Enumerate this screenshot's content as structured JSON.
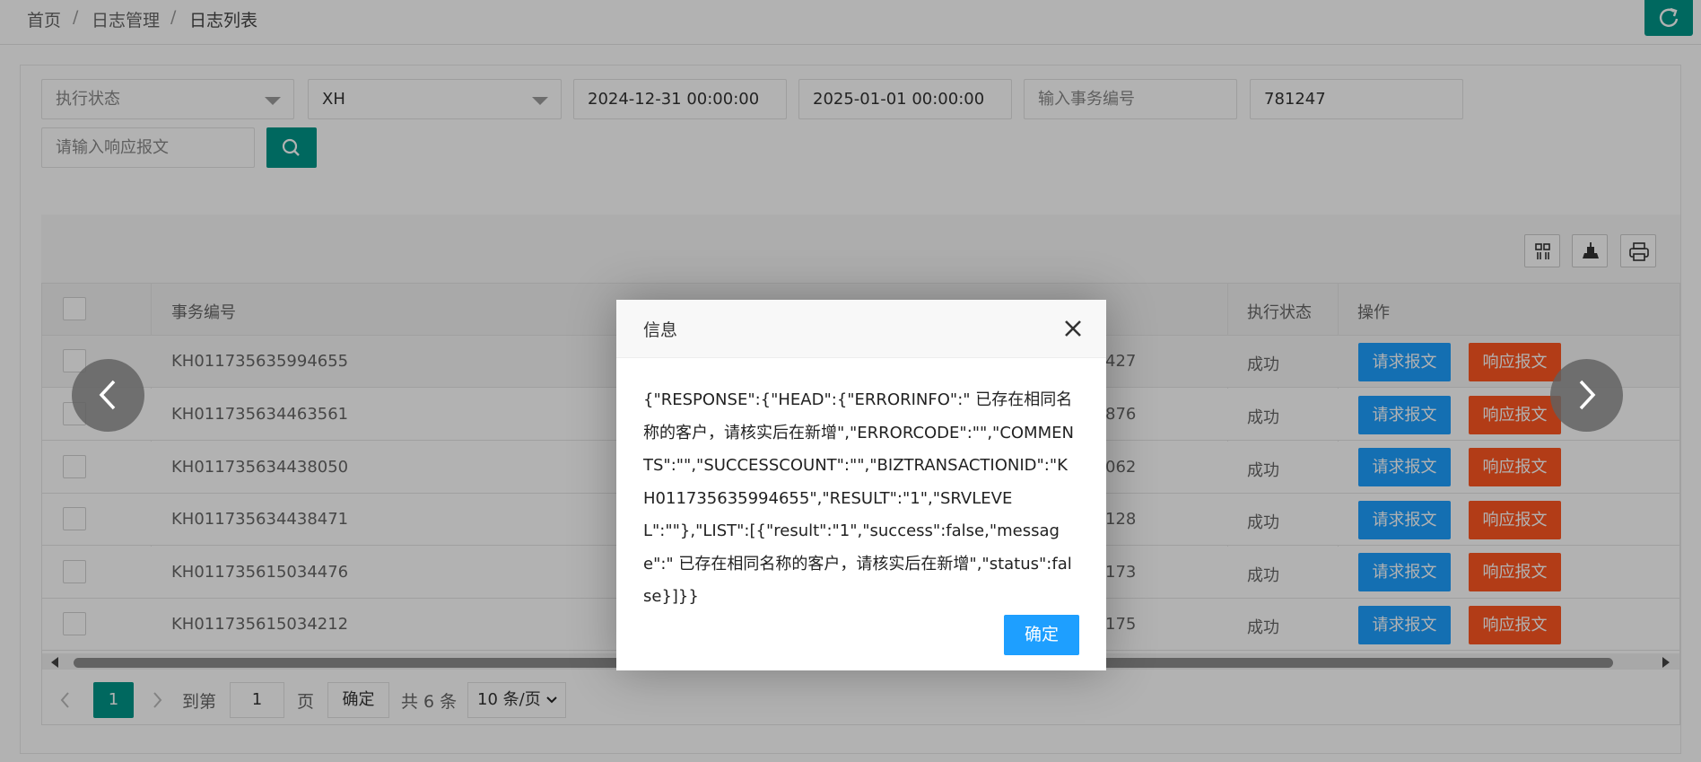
{
  "breadcrumb": {
    "home": "首页",
    "separator": "/",
    "section": "日志管理",
    "current": "日志列表"
  },
  "header": {
    "refresh_icon": "refresh-icon",
    "accent": "#009688"
  },
  "filters": {
    "status_select": {
      "value": "执行状态"
    },
    "system_select": {
      "value": "XH"
    },
    "start_time": {
      "value": "2024-12-31 00:00:00"
    },
    "end_time": {
      "value": "2025-01-01 00:00:00"
    },
    "transaction_no": {
      "placeholder": "输入事务编号"
    },
    "keyword": {
      "value": "781247"
    },
    "response_text": {
      "placeholder": "请输入响应报文"
    },
    "search_icon": "search-icon"
  },
  "toolbar": {
    "icons": [
      "columns-icon",
      "export-icon",
      "print-icon"
    ]
  },
  "table": {
    "headers": {
      "transaction_no": "事务编号",
      "status": "执行状态",
      "actions": "操作"
    },
    "rows": [
      {
        "transaction_no": "KH011735635994655",
        "code": "427",
        "status": "成功"
      },
      {
        "transaction_no": "KH011735634463561",
        "code": "876",
        "status": "成功"
      },
      {
        "transaction_no": "KH011735634438050",
        "code": "062",
        "status": "成功"
      },
      {
        "transaction_no": "KH011735634438471",
        "code": "128",
        "status": "成功"
      },
      {
        "transaction_no": "KH011735615034476",
        "code": "173",
        "status": "成功"
      },
      {
        "transaction_no": "KH011735615034212",
        "code": "175",
        "status": "成功"
      }
    ],
    "request_label": "请求报文",
    "response_label": "响应报文",
    "colors": {
      "request": "#1e9fff",
      "response": "#ff5722"
    }
  },
  "pager": {
    "current_page": "1",
    "goto_label": "到第",
    "page_input": "1",
    "page_unit": "页",
    "confirm": "确定",
    "total": "共 6 条",
    "page_size": "10 条/页"
  },
  "dialog": {
    "title": "信息",
    "close_icon": "close-icon",
    "content": "{\"RESPONSE\":{\"HEAD\":{\"ERRORINFO\":\" 已存在相同名称的客户，请核实后在新增\",\"ERRORCODE\":\"\",\"COMMENTS\":\"\",\"SUCCESSCOUNT\":\"\",\"BIZTRANSACTIONID\":\"KH011735635994655\",\"RESULT\":\"1\",\"SRVLEVEL\":\"\"},\"LIST\":[{\"result\":\"1\",\"success\":false,\"message\":\" 已存在相同名称的客户，请核实后在新增\",\"status\":false}]}}",
    "ok_label": "确定"
  },
  "nav_arrows": {
    "prev_icon": "chevron-left-icon",
    "next_icon": "chevron-right-icon"
  }
}
